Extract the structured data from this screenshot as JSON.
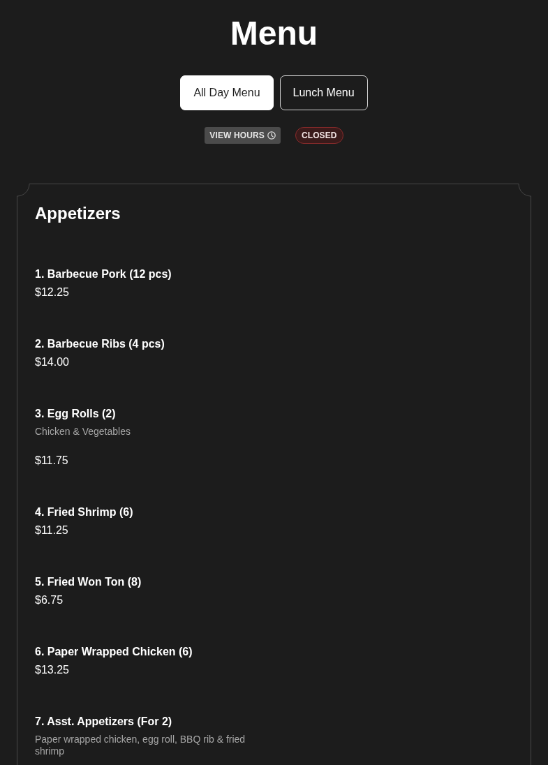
{
  "page": {
    "title": "Menu"
  },
  "menu_tabs": [
    {
      "label": "All Day Menu",
      "selected": true
    },
    {
      "label": "Lunch Menu",
      "selected": false
    }
  ],
  "hours_button": {
    "label": "VIEW HOURS"
  },
  "status_badge": {
    "label": "CLOSED"
  },
  "sections": [
    {
      "title": "Appetizers",
      "items": [
        {
          "name": "1. Barbecue Pork (12 pcs)",
          "price": "$12.25"
        },
        {
          "name": "2. Barbecue Ribs (4 pcs)",
          "price": "$14.00"
        },
        {
          "name": "3. Egg Rolls (2)",
          "description": "Chicken & Vegetables",
          "price": "$11.75"
        },
        {
          "name": "4. Fried Shrimp (6)",
          "price": "$11.25"
        },
        {
          "name": "5. Fried Won Ton (8)",
          "price": "$6.75"
        },
        {
          "name": "6. Paper Wrapped Chicken (6)",
          "price": "$13.25"
        },
        {
          "name": "7. Asst. Appetizers (For 2)",
          "description": "Paper wrapped chicken, egg roll, BBQ rib & fried shrimp"
        }
      ]
    }
  ]
}
